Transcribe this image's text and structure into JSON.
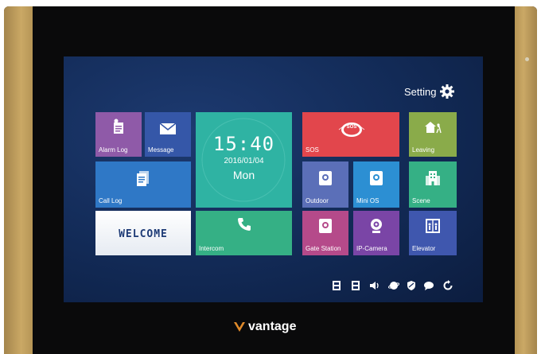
{
  "settings": {
    "label": "Setting"
  },
  "tiles": {
    "alarm_log": "Alarm Log",
    "message": "Message",
    "call_log": "Call Log",
    "welcome": "WELCOME",
    "intercom": "Intercom",
    "sos": "SOS",
    "sos_badge": "SOS",
    "outdoor": "Outdoor",
    "mini_os": "Mini OS",
    "gate_station": "Gate Station",
    "ip_camera": "IP-Camera",
    "leaving": "Leaving",
    "scene": "Scene",
    "elevator": "Elevator"
  },
  "clock": {
    "time": "15:40",
    "date": "2016/01/04",
    "day": "Mon"
  },
  "status_icons": [
    "sd-card-icon",
    "sd-card-icon",
    "volume-icon",
    "globe-icon",
    "shield-icon",
    "chat-icon",
    "refresh-icon"
  ],
  "brand": {
    "name": "vantage"
  },
  "colors": {
    "purple": "#8f5aa8",
    "blue": "#2f78c6",
    "navy_blue": "#3557a8",
    "teal": "#2fb3a3",
    "red": "#e2464c",
    "slate": "#5b6fb8",
    "sky": "#2c8fd3",
    "magenta": "#b54a8a",
    "violet": "#7a45a6",
    "olive_green": "#8aab4a",
    "green": "#35b085",
    "indigo": "#3f57ae",
    "gold": "#c3a15e"
  }
}
